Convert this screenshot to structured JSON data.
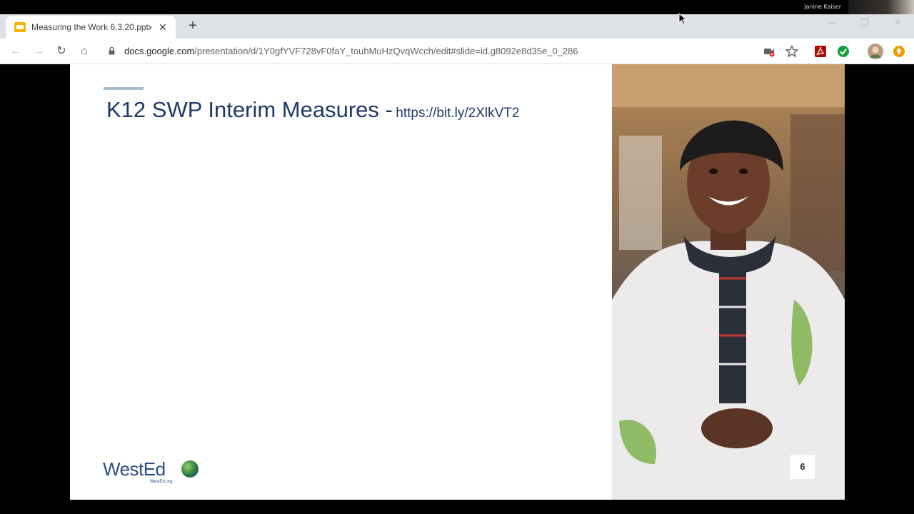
{
  "meeting": {
    "participant_name": "Janine Kaiser"
  },
  "browser": {
    "tab": {
      "title": "Measuring the Work 6.3.20.pptx"
    },
    "url": {
      "host": "docs.google.com",
      "path": "/presentation/d/1Y0gfYVF728vF0faY_touhMuHzQvqWcch/edit#slide=id.g8092e8d35e_0_286"
    }
  },
  "slide": {
    "title": "K12 SWP Interim Measures -",
    "title_link": "https://bit.ly/2XlkVT2",
    "logo_text": "WestEd",
    "logo_subtext": "WestEd.org",
    "page_number": "6"
  },
  "colors": {
    "title": "#1f3a68",
    "accent_rule": "#a9bccd",
    "tab_bar": "#dee1e6"
  }
}
